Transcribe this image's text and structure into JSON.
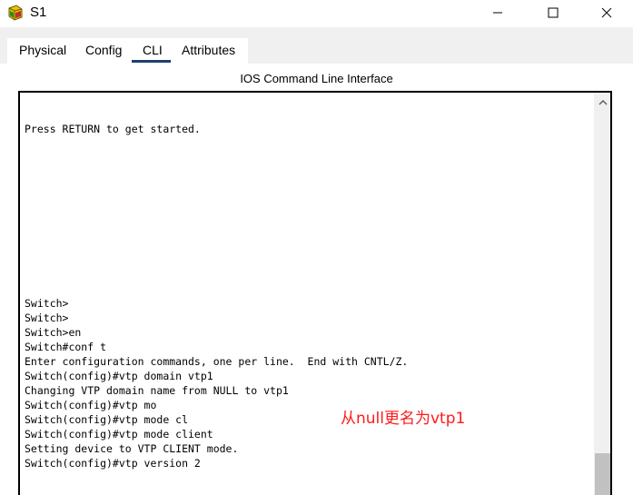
{
  "window": {
    "title": "S1",
    "icon": "switch-icon",
    "controls": [
      "minimize-icon",
      "maximize-icon",
      "close-icon"
    ]
  },
  "tabs": [
    {
      "label": "Physical",
      "active": false
    },
    {
      "label": "Config",
      "active": false
    },
    {
      "label": "CLI",
      "active": true
    },
    {
      "label": "Attributes",
      "active": false
    }
  ],
  "panel": {
    "title": "IOS Command Line Interface"
  },
  "console": {
    "lines": [
      "",
      "",
      "Press RETURN to get started.",
      "",
      "",
      "",
      "",
      "",
      "",
      "",
      "",
      "",
      "",
      "",
      "Switch>",
      "Switch>",
      "Switch>en",
      "Switch#conf t",
      "Enter configuration commands, one per line.  End with CNTL/Z.",
      "Switch(config)#vtp domain vtp1",
      "Changing VTP domain name from NULL to vtp1",
      "Switch(config)#vtp mo",
      "Switch(config)#vtp mode cl",
      "Switch(config)#vtp mode client",
      "Setting device to VTP CLIENT mode.",
      "Switch(config)#vtp version 2"
    ]
  },
  "annotation": {
    "text": "从null更名为vtp1",
    "color": "#ff1a1a"
  },
  "colors": {
    "tab_bar_bg": "#f0f0f0",
    "active_tab_underline": "#1f3f6f",
    "scroll_thumb": "#c1c1c1"
  }
}
